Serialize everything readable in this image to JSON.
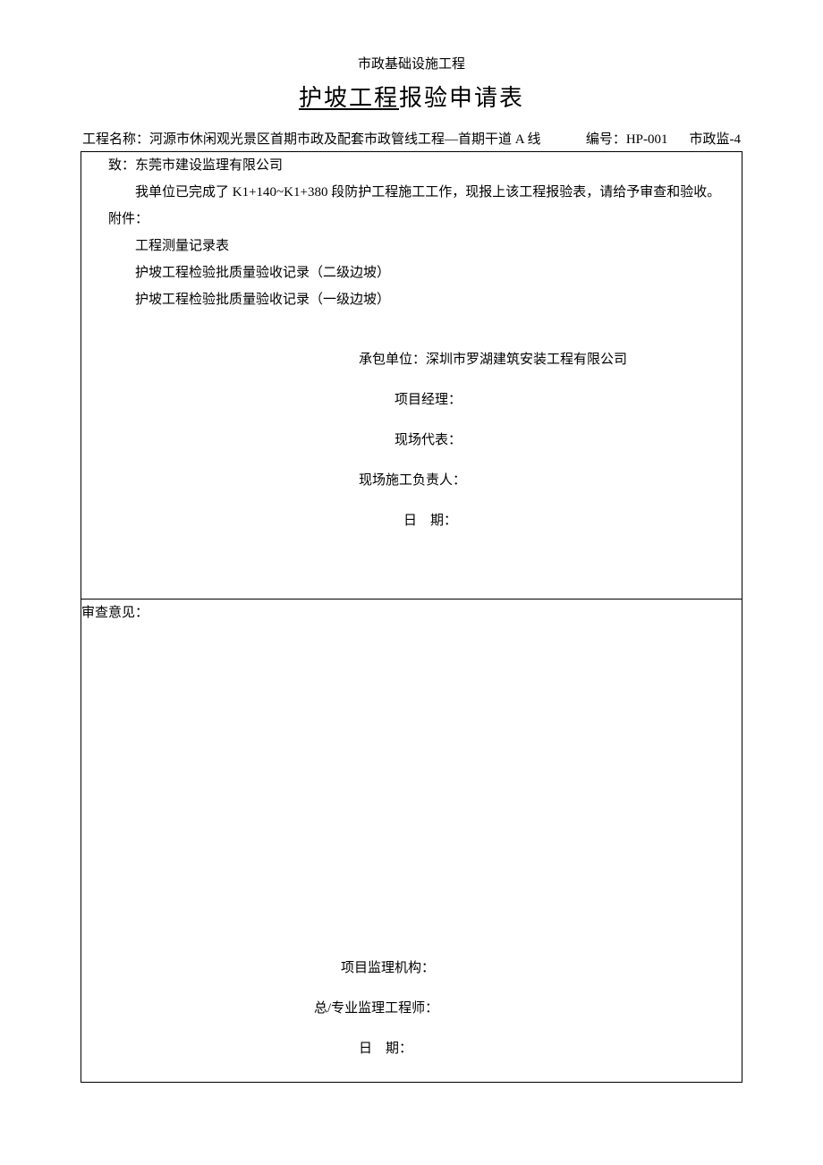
{
  "header": {
    "small_title": "市政基础设施工程",
    "main_title_underlined": "护坡工程",
    "main_title_rest": "报验申请表"
  },
  "info": {
    "project_name_label": "工程名称：",
    "project_name_value": "河源市休闲观光景区首期市政及配套市政管线工程—首期干道 A 线",
    "number_label": "编号：",
    "number_value": "HP-001",
    "form_code": "市政监-4"
  },
  "upper": {
    "to_line": "致：东莞市建设监理有限公司",
    "body_line": "我单位已完成了 K1+140~K1+380 段防护工程施工工作，现报上该工程报验表，请给予审查和验收。",
    "attach_label": "附件：",
    "attach_items": [
      "工程测量记录表",
      "护坡工程检验批质量验收记录（二级边坡）",
      "护坡工程检验批质量验收记录（一级边坡）"
    ],
    "sig": {
      "contractor_label": "承包单位：",
      "contractor_value": "深圳市罗湖建筑安装工程有限公司",
      "pm_label": "项目经理：",
      "rep_label": "现场代表：",
      "site_label": "现场施工负责人：",
      "date_label_pre": "日",
      "date_label_post": "期："
    }
  },
  "lower": {
    "opinion_label": "审查意见：",
    "sig": {
      "org_label": "项目监理机构：",
      "engineer_label": "总/专业监理工程师：",
      "date_label_pre": "日",
      "date_label_post": "期："
    }
  }
}
